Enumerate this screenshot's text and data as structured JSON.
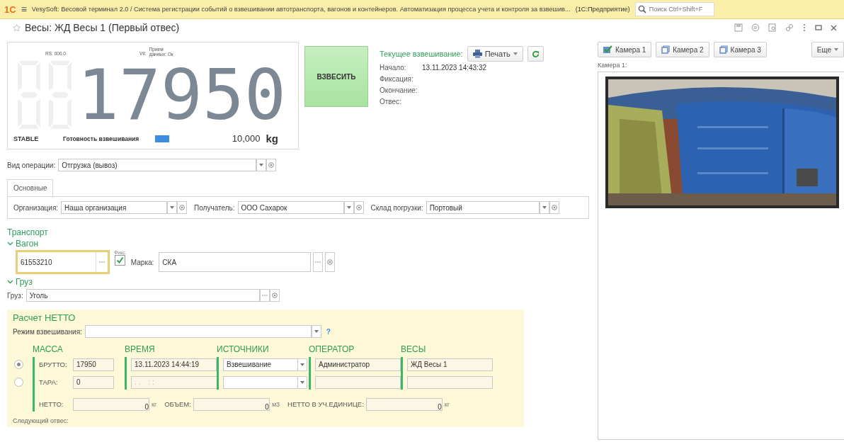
{
  "app_bar": {
    "logo": "1С",
    "menu": "≡",
    "title": "VesySoft: Весовой терминал 2.0 / Система регистрации событий о взвешивании автотранспорта, вагонов и контейнеров. Автоматизация процесса учета и контроля за взвешив...",
    "platform": "(1С:Предприятие)",
    "search": {
      "placeholder": "Поиск Ctrl+Shift+F"
    }
  },
  "form": {
    "title": "Весы: ЖД Весы 1 (Первый отвес)",
    "favorite": false
  },
  "display": {
    "top_left": "RS: 000.0",
    "top_mid_prefix": "VII:",
    "top_mid": "Прием данных: Ок",
    "value": "17950",
    "status": "STABLE",
    "readiness": "Готовность взвешивания",
    "reading": "10,000",
    "unit": "kg"
  },
  "weigh_button": "ВЗВЕСИТЬ",
  "current": {
    "label": "Текущее взвешивание:",
    "print_button": "Печать",
    "rows": [
      {
        "label": "Начало:",
        "value": "13.11.2023 14:43:32"
      },
      {
        "label": "Фиксация:"
      },
      {
        "label": "Окончание:"
      },
      {
        "label": "Отвес:"
      }
    ]
  },
  "operation": {
    "label": "Вид операции:",
    "value": "Отгрузка (вывоз)"
  },
  "tabs": [
    {
      "label": "Основные",
      "selected": true
    }
  ],
  "main_fields": [
    {
      "label": "Организация:",
      "value": "Наша организация"
    },
    {
      "label": "Получатель:",
      "value": "ООО Сахарок"
    },
    {
      "label": "Склад погрузки:",
      "value": "Портовый"
    }
  ],
  "transport": {
    "title": "Транспорт",
    "wagon": {
      "title": "Вагон",
      "expanded": true,
      "number": "61553210",
      "fix_label": "Фикс.",
      "fixed": true,
      "brand_label": "Марка:",
      "brand": "СКА"
    },
    "cargo": {
      "title": "Груз",
      "expanded": true,
      "label": "Груз:",
      "value": "Уголь"
    }
  },
  "net": {
    "title": "Расчет НЕТТО",
    "mode_label": "Режим взвешивания:",
    "help": "?",
    "columns": [
      "МАССА",
      "ВРЕМЯ",
      "ИСТОЧНИКИ",
      "ОПЕРАТОР",
      "ВЕСЫ"
    ],
    "rows": [
      {
        "selected": true,
        "label": "БРУТТО:",
        "mass": "17950",
        "time": "13.11.2023 14:44:19",
        "source": "Взвешивание",
        "operator": "Администратор",
        "scales": "ЖД Весы 1"
      },
      {
        "selected": false,
        "label": "ТАРА:",
        "mass": "0",
        "time_placeholder": ". .    : :"
      }
    ],
    "totals": [
      {
        "label": "НЕТТО:",
        "value": "0",
        "unit": "кг"
      },
      {
        "label": "ОБЪЕМ:",
        "value": "0",
        "unit": "м3"
      },
      {
        "label": "НЕТТО В УЧ.ЕДИНИЦЕ:",
        "value": "0",
        "unit": "кг"
      }
    ],
    "footer": "Следующий отвес:"
  },
  "cameras": {
    "buttons": [
      {
        "label": "Камера 1",
        "selected": true
      },
      {
        "label": "Камера 2",
        "selected": false
      },
      {
        "label": "Камера 3",
        "selected": false
      }
    ],
    "more": "Еще",
    "label": "Камера 1:"
  }
}
